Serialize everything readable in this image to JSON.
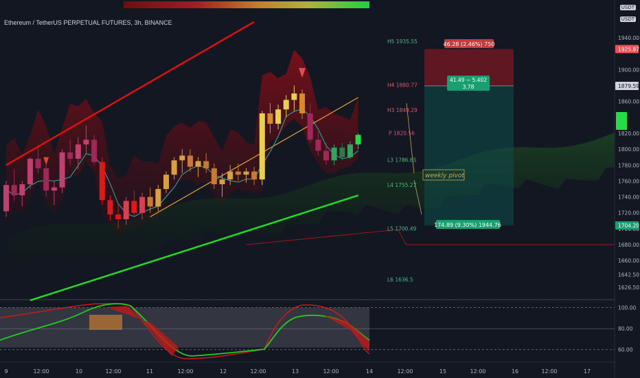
{
  "header": {
    "title": "Ethereum / TetherUS PERPETUAL FUTURES, 3h, BINANCE",
    "currency_top": "USDT",
    "currency_second": "USDT"
  },
  "colors": {
    "background": "#131722",
    "up_candle": "#d4a84b",
    "down_candle": "#cc2222",
    "pivot_text": "#3fbf86",
    "resistance_text": "#e05a6a",
    "pivot_p_text": "#d84a8a",
    "channel_upper": "#e01010",
    "channel_lower": "#22dd22",
    "trend_line": "#f0a030",
    "ma_line": "#2ab0a8"
  },
  "chart_data": {
    "type": "line",
    "title": "Ethereum / TetherUS PERPETUAL FUTURES, 3h, BINANCE",
    "price_axis": {
      "ylim": [
        1610,
        1960
      ],
      "ticks": [
        "1940.00",
        "1900.00",
        "1860.00",
        "1820.00",
        "1800.00",
        "1780.00",
        "1760.00",
        "1740.00",
        "1720.00",
        "1700.00",
        "1680.00",
        "1660.00",
        "1642.50",
        "1626.50"
      ],
      "labels": [
        {
          "text": "1925.87",
          "style": "red"
        },
        {
          "text": "1879.59",
          "style": "white"
        },
        {
          "text": "1704.20",
          "style": "green"
        }
      ]
    },
    "time_axis": [
      "9",
      "12:00",
      "10",
      "12:00",
      "11",
      "12:00",
      "12",
      "12:00",
      "13",
      "12:00",
      "14",
      "12:00",
      "15",
      "12:00",
      "16",
      "12:00",
      "17"
    ],
    "pivot_levels": [
      {
        "label": "H5 1935.55",
        "value": 1935.55,
        "style": "support"
      },
      {
        "label": "H4 1880.77",
        "value": 1880.77,
        "style": "resistance"
      },
      {
        "label": "H3 1849.29",
        "value": 1849.29,
        "style": "resistance"
      },
      {
        "label": "P 1820.56",
        "value": 1820.56,
        "style": "pivot"
      },
      {
        "label": "L3 1786.65",
        "value": 1786.65,
        "style": "support"
      },
      {
        "label": "L4 1755.27",
        "value": 1755.27,
        "style": "support"
      },
      {
        "label": "L5 1700.49",
        "value": 1700.49,
        "style": "support"
      },
      {
        "label": "L6 1636.5",
        "value": 1636.5,
        "style": "support"
      }
    ],
    "candles_ohlc": [
      [
        1722,
        1760,
        1715,
        1755
      ],
      [
        1755,
        1775,
        1735,
        1742
      ],
      [
        1742,
        1760,
        1728,
        1756
      ],
      [
        1756,
        1790,
        1750,
        1788
      ],
      [
        1788,
        1805,
        1770,
        1776
      ],
      [
        1776,
        1790,
        1740,
        1748
      ],
      [
        1748,
        1760,
        1730,
        1752
      ],
      [
        1752,
        1800,
        1745,
        1796
      ],
      [
        1796,
        1812,
        1780,
        1788
      ],
      [
        1788,
        1815,
        1775,
        1806
      ],
      [
        1806,
        1830,
        1795,
        1812
      ],
      [
        1812,
        1818,
        1780,
        1784
      ],
      [
        1784,
        1790,
        1730,
        1736
      ],
      [
        1736,
        1742,
        1710,
        1718
      ],
      [
        1718,
        1730,
        1700,
        1712
      ],
      [
        1712,
        1740,
        1705,
        1735
      ],
      [
        1735,
        1748,
        1715,
        1720
      ],
      [
        1720,
        1745,
        1712,
        1740
      ],
      [
        1740,
        1752,
        1720,
        1728
      ],
      [
        1728,
        1755,
        1722,
        1750
      ],
      [
        1750,
        1772,
        1745,
        1768
      ],
      [
        1768,
        1790,
        1762,
        1786
      ],
      [
        1786,
        1800,
        1770,
        1792
      ],
      [
        1792,
        1800,
        1772,
        1778
      ],
      [
        1778,
        1790,
        1765,
        1785
      ],
      [
        1785,
        1795,
        1770,
        1776
      ],
      [
        1776,
        1782,
        1750,
        1756
      ],
      [
        1756,
        1770,
        1740,
        1762
      ],
      [
        1762,
        1780,
        1755,
        1772
      ],
      [
        1772,
        1782,
        1760,
        1768
      ],
      [
        1768,
        1776,
        1758,
        1772
      ],
      [
        1772,
        1778,
        1755,
        1762
      ],
      [
        1762,
        1848,
        1755,
        1845
      ],
      [
        1845,
        1858,
        1820,
        1832
      ],
      [
        1832,
        1856,
        1825,
        1850
      ],
      [
        1850,
        1868,
        1840,
        1862
      ],
      [
        1862,
        1880,
        1848,
        1870
      ],
      [
        1870,
        1875,
        1838,
        1845
      ],
      [
        1845,
        1858,
        1808,
        1812
      ],
      [
        1812,
        1822,
        1792,
        1798
      ],
      [
        1798,
        1808,
        1780,
        1786
      ],
      [
        1786,
        1806,
        1780,
        1802
      ],
      [
        1802,
        1808,
        1786,
        1790
      ],
      [
        1790,
        1810,
        1788,
        1806
      ],
      [
        1806,
        1820,
        1800,
        1818
      ]
    ],
    "channel": {
      "upper": [
        [
          0,
          1780
        ],
        [
          31,
          1960
        ]
      ],
      "lower": [
        [
          3,
          1610
        ],
        [
          44,
          1742
        ]
      ]
    },
    "trend_line": [
      [
        18,
        1715
      ],
      [
        44,
        1865
      ]
    ],
    "position": {
      "target_label": "46.28 (2.46%) 750",
      "center_label": "41.49 ~ 5.402",
      "center_sub": "3.78",
      "stop_label": "174.89 (9.30%) 1944.76",
      "entry": 1879.59,
      "target": 1925.87,
      "stop": 1704.2
    },
    "annotation": "weekly pivot",
    "oscillator": {
      "ticks": [
        "100.00",
        "80.00",
        "60.00"
      ],
      "ylim": [
        50,
        105
      ]
    }
  }
}
